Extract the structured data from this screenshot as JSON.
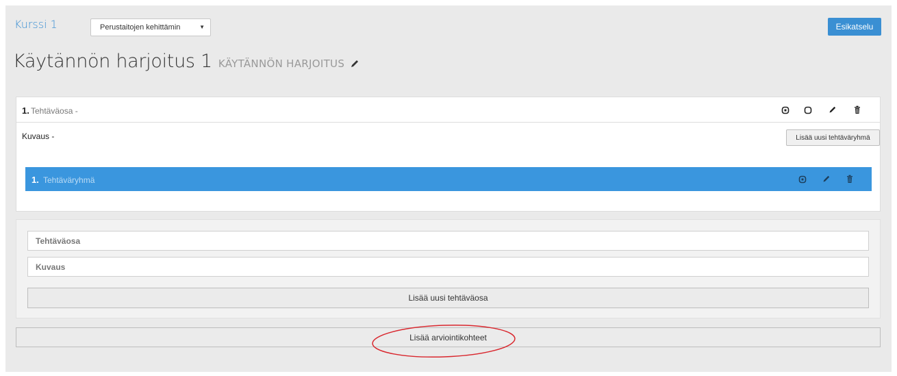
{
  "header": {
    "course_link": "Kurssi 1",
    "course_select_value": "Perustaitojen kehittämin",
    "preview_label": "Esikatselu"
  },
  "title": {
    "main": "Käytännön harjoitus 1",
    "subtitle": "KÄYTÄNNÖN HARJOITUS"
  },
  "section": {
    "number": "1.",
    "label": "Tehtäväosa -",
    "description": "Kuvaus -",
    "add_group_label": "Lisää uusi tehtäväryhmä",
    "group": {
      "number": "1.",
      "label": "Tehtäväryhmä"
    }
  },
  "form": {
    "section_placeholder": "Tehtäväosa",
    "description_placeholder": "Kuvaus",
    "add_section_label": "Lisää uusi tehtäväosa"
  },
  "footer": {
    "add_criteria_label": "Lisää arviointikohteet"
  },
  "colors": {
    "accent": "#3a8fd3",
    "group_bar": "#3a96de",
    "annotation": "#d9262d"
  }
}
